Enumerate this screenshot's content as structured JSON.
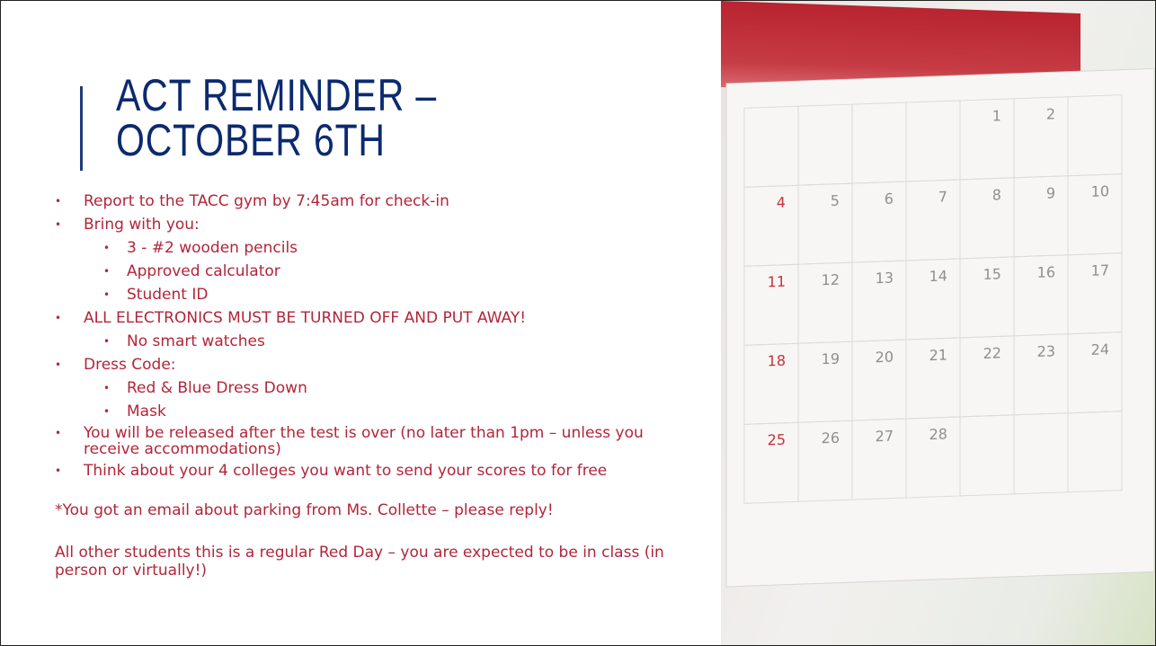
{
  "title": "ACT REMINDER – OCTOBER 6TH",
  "bullets": {
    "report": "Report to the TACC gym by 7:45am for check-in",
    "bring": "Bring with you:",
    "pencils": "3 - #2 wooden pencils",
    "calculator": "Approved calculator",
    "student_id": "Student ID",
    "electronics": "ALL ELECTRONICS MUST BE TURNED OFF AND PUT AWAY!",
    "watches": "No smart watches",
    "dress_code": "Dress Code:",
    "dress_down": "Red & Blue Dress Down",
    "mask": "Mask",
    "released": "You will be released after the test is over (no later than 1pm – unless you receive accommodations)",
    "colleges": "Think about your 4 colleges you want to send your scores to for free"
  },
  "notes": {
    "parking": "*You got an email about parking from Ms. Collette – please reply!",
    "red_day": "All other students this is a regular Red Day – you are expected to be in class (in person or virtually!)"
  },
  "calendar": {
    "rows": [
      [
        "",
        "",
        "",
        "",
        "1",
        "2",
        ""
      ],
      [
        "4",
        "5",
        "6",
        "7",
        "8",
        "9",
        "10"
      ],
      [
        "11",
        "12",
        "13",
        "14",
        "15",
        "16",
        "17"
      ],
      [
        "18",
        "19",
        "20",
        "21",
        "22",
        "23",
        "24"
      ],
      [
        "25",
        "26",
        "27",
        "28",
        "",
        "",
        ""
      ]
    ],
    "accent_color": "#c8303a"
  }
}
